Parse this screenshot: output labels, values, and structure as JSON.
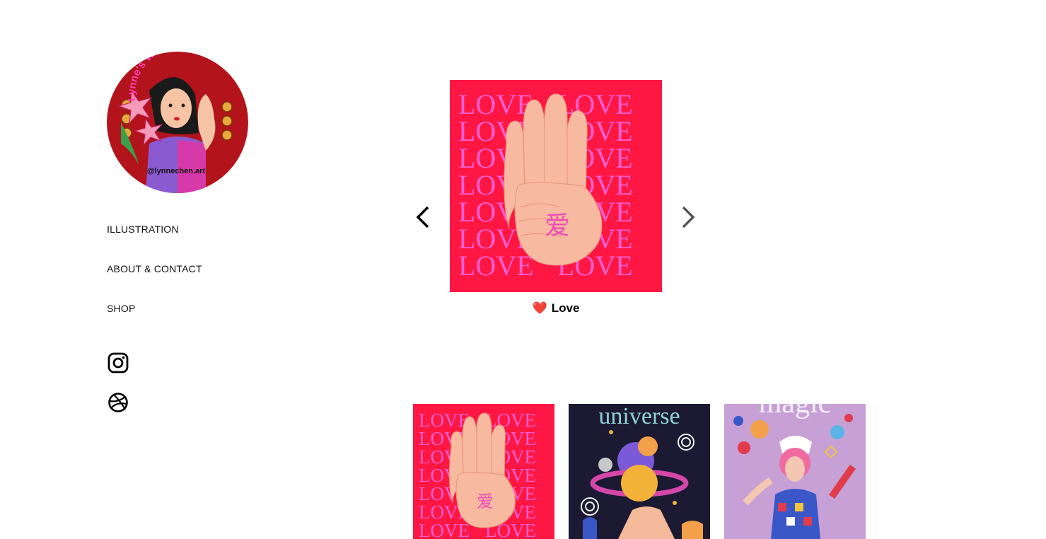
{
  "sidebar": {
    "avatar_text_top": "Lynne's Wonderland",
    "avatar_text_bottom": "@lynnechen.art",
    "nav": [
      {
        "label": "ILLUSTRATION"
      },
      {
        "label": "ABOUT & CONTACT"
      },
      {
        "label": "SHOP"
      }
    ],
    "socials": [
      {
        "icon": "instagram-icon"
      },
      {
        "icon": "dribbble-icon"
      }
    ]
  },
  "viewer": {
    "love_word": "LOVE",
    "hanzi": "爱",
    "caption_heart": "❤️",
    "caption": "Love"
  },
  "thumbnails": [
    {
      "title": "Love",
      "word": "LOVE",
      "hanzi": "爱"
    },
    {
      "title": "Universe",
      "word": "universe"
    },
    {
      "title": "Magic",
      "word": "magic"
    }
  ],
  "colors": {
    "love_bg": "#ff1744",
    "love_text": "#ff5fd2",
    "avatar_bg": "#b3131b",
    "universe_bg": "#1c1933",
    "magic_bg": "#c7a1d6"
  }
}
